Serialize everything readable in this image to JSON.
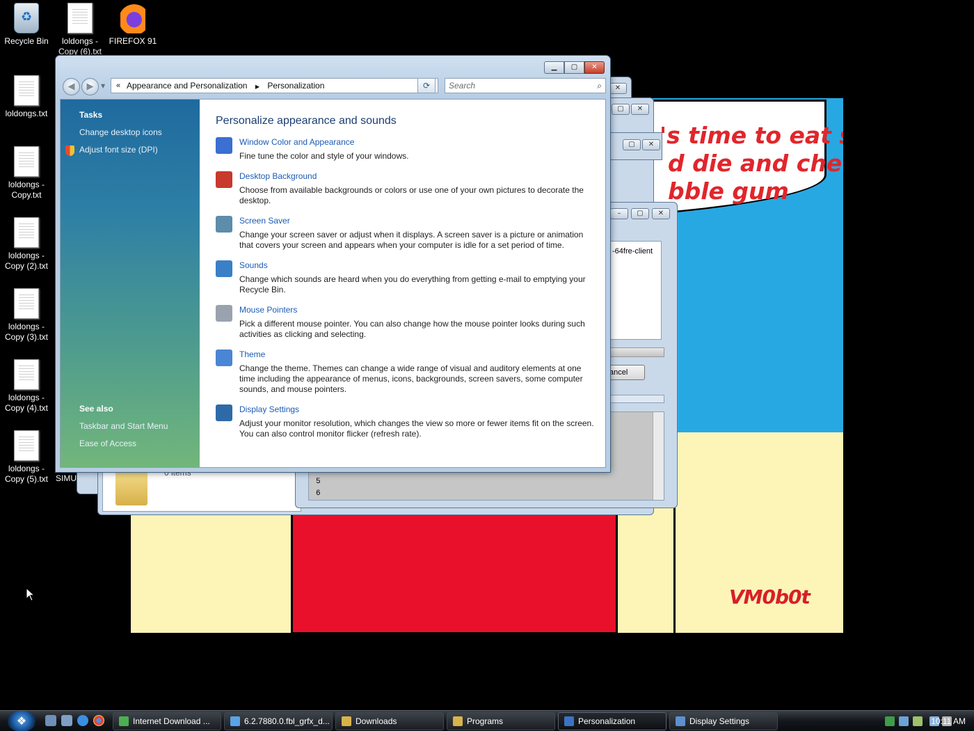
{
  "wallpaper": {
    "lines": [
      "'s time to eat shi",
      "d die and chew",
      "bble gum"
    ],
    "signature": "VM0b0t"
  },
  "desktop_icons": [
    {
      "label": "Recycle Bin",
      "icon": "recycle-bin-icon"
    },
    {
      "label": "loldongs - Copy (6).txt",
      "icon": "text-file-icon"
    },
    {
      "label": "FIREFOX 91",
      "icon": "firefox-icon"
    },
    {
      "label": "loldongs.txt",
      "icon": "text-file-icon"
    },
    {
      "label": "loldongs - Copy.txt",
      "icon": "text-file-icon"
    },
    {
      "label": "loldongs - Copy (2).txt",
      "icon": "text-file-icon"
    },
    {
      "label": "loldongs - Copy (3).txt",
      "icon": "text-file-icon"
    },
    {
      "label": "loldongs - Copy (4).txt",
      "icon": "text-file-icon"
    },
    {
      "label": "loldongs - Copy (5).txt",
      "icon": "text-file-icon"
    }
  ],
  "background_windows": {
    "partial_label": "SIMU",
    "items_text": "0 items",
    "client_text": "-64fre-client",
    "cancel_label": "ancel",
    "list_numbers": [
      "5",
      "6"
    ]
  },
  "window": {
    "title": "Personalization",
    "breadcrumb": [
      "Appearance and Personalization",
      "Personalization"
    ],
    "search_placeholder": "Search",
    "tasks_header": "Tasks",
    "tasks": [
      "Change desktop icons",
      "Adjust font size (DPI)"
    ],
    "see_also_header": "See also",
    "see_also": [
      "Taskbar and Start Menu",
      "Ease of Access"
    ],
    "heading": "Personalize appearance and sounds",
    "items": [
      {
        "title": "Window Color and Appearance",
        "desc": "Fine tune the color and style of your windows.",
        "icon": "window-color-icon",
        "color": "#3b6fd1"
      },
      {
        "title": "Desktop Background",
        "desc": "Choose from available backgrounds or colors or use one of your own pictures to decorate the desktop.",
        "icon": "desktop-background-icon",
        "color": "#c8392e"
      },
      {
        "title": "Screen Saver",
        "desc": "Change your screen saver or adjust when it displays. A screen saver is a picture or animation that covers your screen and appears when your computer is idle for a set period of time.",
        "icon": "screen-saver-icon",
        "color": "#5e8cab"
      },
      {
        "title": "Sounds",
        "desc": "Change which sounds are heard when you do everything from getting e-mail to emptying your Recycle Bin.",
        "icon": "sounds-icon",
        "color": "#3a7fc7"
      },
      {
        "title": "Mouse Pointers",
        "desc": "Pick a different mouse pointer. You can also change how the mouse pointer looks during such activities as clicking and selecting.",
        "icon": "mouse-pointers-icon",
        "color": "#9aa3ad"
      },
      {
        "title": "Theme",
        "desc": "Change the theme. Themes can change a wide range of visual and auditory elements at one time including the appearance of menus, icons, backgrounds, screen savers, some computer sounds, and mouse pointers.",
        "icon": "theme-icon",
        "color": "#4a86d4"
      },
      {
        "title": "Display Settings",
        "desc": "Adjust your monitor resolution, which changes the view so more or fewer items fit on the screen. You can also control monitor flicker (refresh rate).",
        "icon": "display-settings-icon",
        "color": "#2f6aa8"
      }
    ]
  },
  "taskbar": {
    "buttons": [
      {
        "label": "Internet Download ...",
        "icon": "download-manager-icon",
        "color": "#4caf50"
      },
      {
        "label": "6.2.7880.0.fbl_grfx_d...",
        "icon": "ie-icon",
        "color": "#5aa4e6"
      },
      {
        "label": "Downloads",
        "icon": "folder-icon",
        "color": "#d9b34a"
      },
      {
        "label": "Programs",
        "icon": "folder-icon",
        "color": "#d9b34a"
      },
      {
        "label": "Personalization",
        "icon": "control-panel-icon",
        "color": "#3b73c4"
      },
      {
        "label": "Display Settings",
        "icon": "display-settings-icon",
        "color": "#5e8fcf"
      }
    ],
    "clock": "10:11 AM"
  }
}
